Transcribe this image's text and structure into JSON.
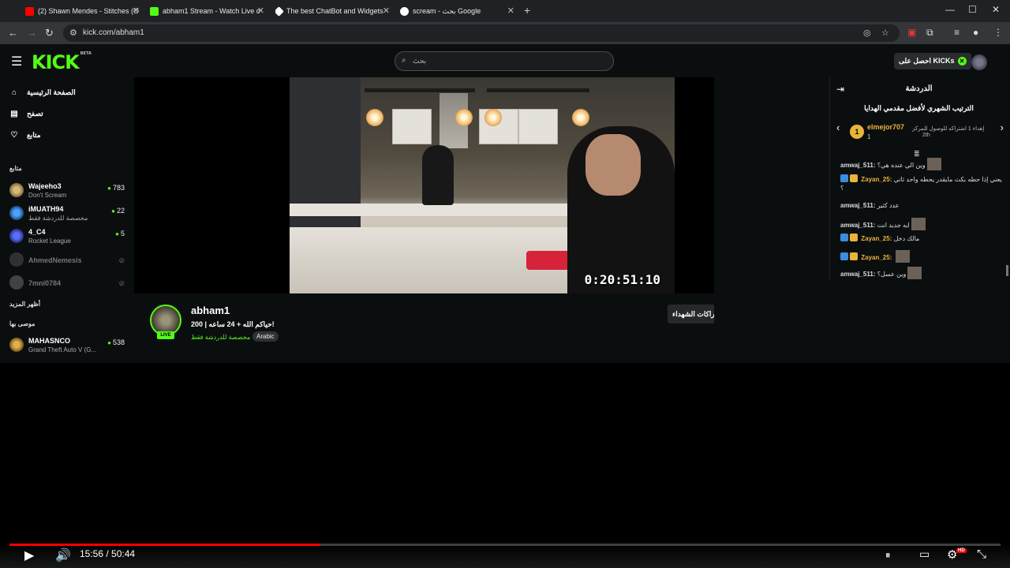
{
  "browser": {
    "tabs": [
      {
        "label": "(2) Shawn Mendes - Stitches (O",
        "color": "#ff0000"
      },
      {
        "label": "abham1 Stream - Watch Live o",
        "color": "#53fc18"
      },
      {
        "label": "The best ChatBot and Widgets",
        "color": "#ffffff"
      },
      {
        "label": "scream - بحث Google",
        "color": "#4285f4"
      }
    ],
    "new_tab": "+",
    "url": "kick.com/abham1"
  },
  "kick": {
    "logo": "KICK",
    "logo_beta": "BETA",
    "search_placeholder": "بحث",
    "get_kicks": "احصل على KICKs",
    "accent": "#53fc18"
  },
  "sidebar": {
    "nav": [
      {
        "label": "الصفحة الرئيسية",
        "icon": "home-icon"
      },
      {
        "label": "تصفح",
        "icon": "browse-icon"
      },
      {
        "label": "متابع",
        "icon": "heart-icon"
      }
    ],
    "following_heading": "متابع",
    "following": [
      {
        "name": "Wajeeho3",
        "category": "Don't Scream",
        "viewers": "783"
      },
      {
        "name": "iMUATH94",
        "category": "مخصصة للدردشة فقط",
        "viewers": "22"
      },
      {
        "name": "4_C4",
        "category": "Rocket League",
        "viewers": "5"
      }
    ],
    "offline": [
      {
        "name": "AhmedNemesis"
      },
      {
        "name": "7mni0784"
      }
    ],
    "show_more": "أظهر المزيد",
    "recommended_heading": "موصى بها",
    "recommended": [
      {
        "name": "MAHASNCO",
        "category": "Grand Theft Auto V (G...",
        "viewers": "538"
      }
    ]
  },
  "player": {
    "overlay_time": "0:20:51:10"
  },
  "stream": {
    "name": "abham1",
    "live": "LIVE",
    "title": "حياكم الله + 24 ساعه | 200!",
    "category": "مخصصة للدردشة فقط",
    "tag": "Arabic",
    "subscribe": "اشتراكات الشهداء"
  },
  "chat": {
    "title": "الدردشة",
    "leaderboard_title": "الترتيب الشهري لأفضل مقدمي الهدايا",
    "top_rank": "1",
    "top_user": "elmejor707",
    "top_count": "1",
    "goal_line1": "إهداء 1 اشتراكه للوصول للمركز",
    "goal_line2": "2th",
    "messages": [
      {
        "user": "amwaj_511:",
        "text": "وين الي عنده هي؟",
        "gold": false,
        "emote": true
      },
      {
        "user": "Zayan_25:",
        "text": "يعني إذا حطه بكث مايقدر يحطه واحد ثاني ؟",
        "gold": true,
        "emote": false
      },
      {
        "user": "amwaj_511:",
        "text": "عدد كثير",
        "gold": false,
        "emote": false
      },
      {
        "user": "amwaj_511:",
        "text": "ايه جديد انت",
        "gold": false,
        "emote": true
      },
      {
        "user": "Zayan_25:",
        "text": "مالك دخل",
        "gold": true,
        "emote": false
      },
      {
        "user": "Zayan_25:",
        "text": "",
        "gold": true,
        "emote": true
      },
      {
        "user": "amwaj_511:",
        "text": "وين عسل؟",
        "gold": false,
        "emote": true
      }
    ]
  },
  "youtube": {
    "time": "15:56 / 50:44",
    "progress": 0.314,
    "hd": "HD"
  }
}
